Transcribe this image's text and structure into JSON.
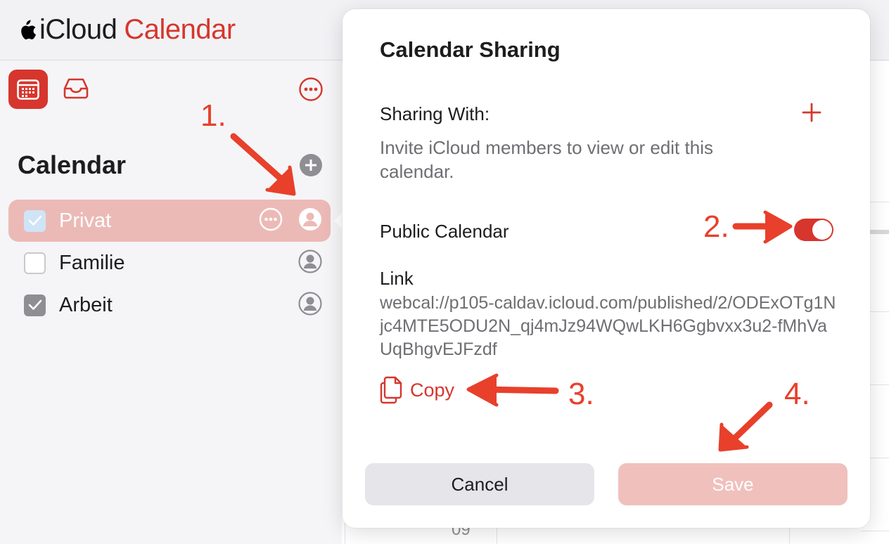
{
  "header": {
    "brand_icloud": "iCloud",
    "brand_calendar": "Calendar"
  },
  "sidebar": {
    "title": "Calendar",
    "calendars": [
      {
        "label": "Privat",
        "checked": true,
        "selected": true
      },
      {
        "label": "Familie",
        "checked": false,
        "selected": false
      },
      {
        "label": "Arbeit",
        "checked": true,
        "selected": false
      }
    ]
  },
  "background": {
    "hour_label": "09"
  },
  "popover": {
    "title": "Calendar Sharing",
    "sharing_with_label": "Sharing With:",
    "sharing_description": "Invite iCloud members to view or edit this calendar.",
    "public_calendar_label": "Public Calendar",
    "public_calendar_on": true,
    "link_label": "Link",
    "link_url": "webcal://p105-caldav.icloud.com/published/2/ODExOTg1Njc4MTE5ODU2N_qj4mJz94WQwLKH6Ggbvxx3u2-fMhVaUqBhgvEJFzdf",
    "copy_label": "Copy",
    "cancel_label": "Cancel",
    "save_label": "Save"
  },
  "annotations": {
    "step1": "1.",
    "step2": "2.",
    "step3": "3.",
    "step4": "4."
  },
  "colors": {
    "accent": "#d6362d",
    "selected_row": "#ecbab6",
    "save_disabled": "#f0c0bd",
    "annotation": "#e8402b"
  }
}
